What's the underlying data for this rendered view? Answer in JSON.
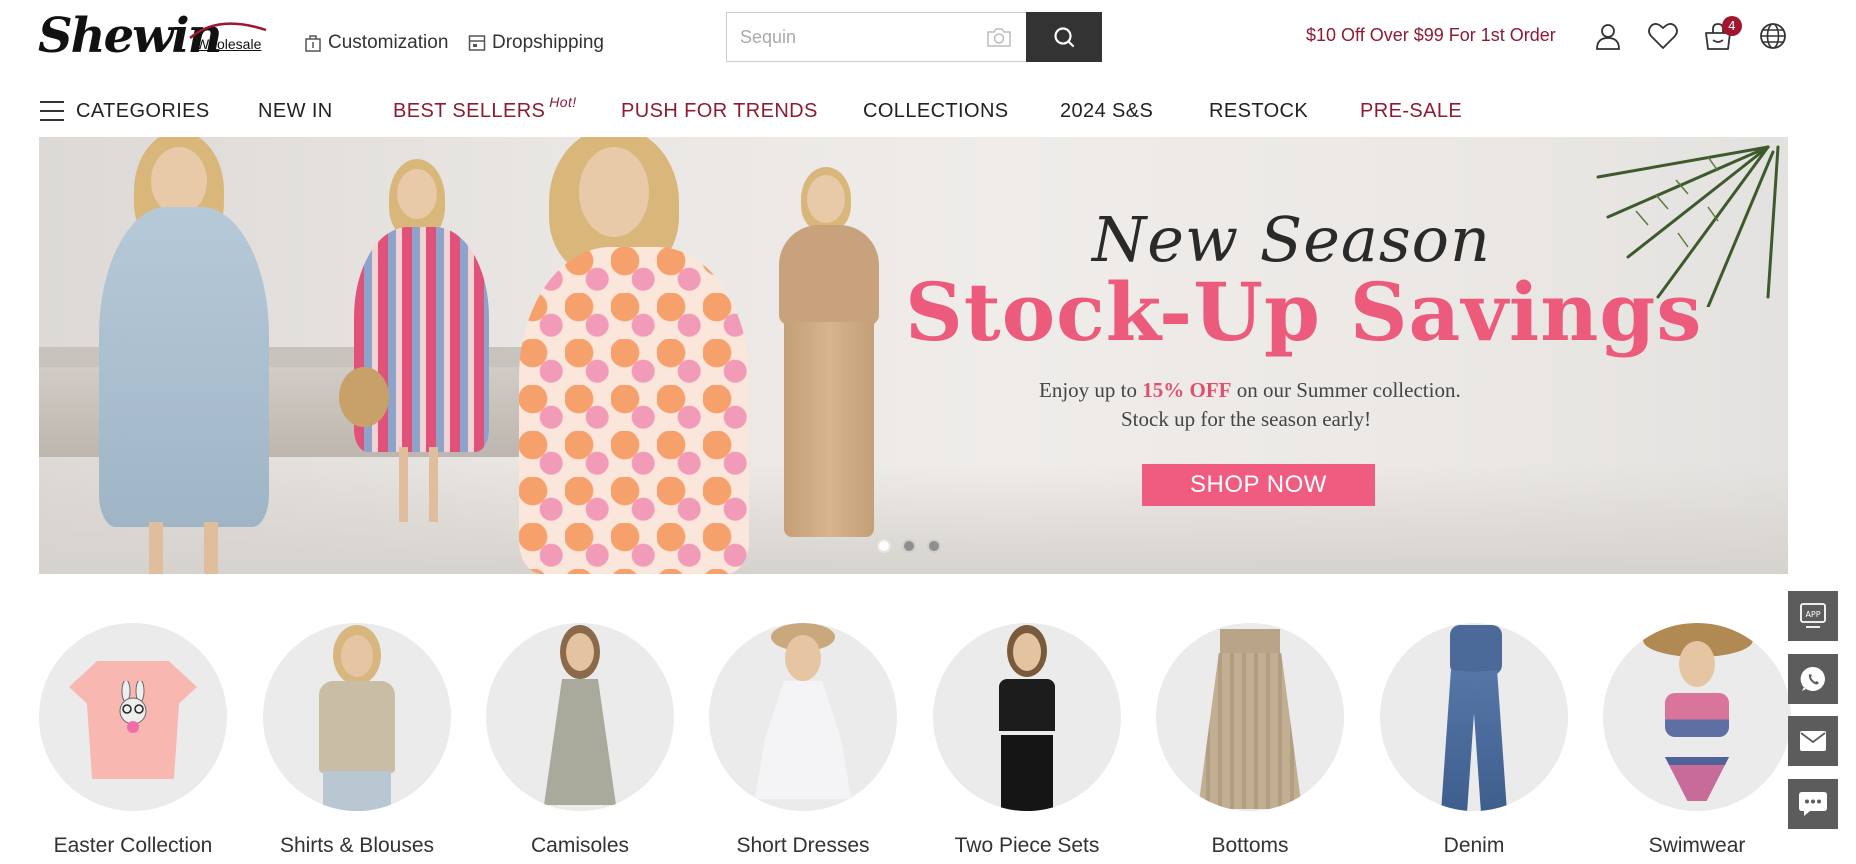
{
  "header": {
    "logo_text": "Shewin",
    "logo_sub": "Wholesale",
    "links": [
      {
        "label": "Customization",
        "icon": "customization-icon"
      },
      {
        "label": "Dropshipping",
        "icon": "dropshipping-icon"
      }
    ],
    "search": {
      "placeholder": "Sequin"
    },
    "promo": "$10 Off Over $99 For 1st Order",
    "cart_count": "4",
    "icons": [
      "account-icon",
      "wishlist-heart-icon",
      "cart-icon",
      "language-globe-icon"
    ]
  },
  "nav": {
    "categories_label": "CATEGORIES",
    "items": [
      {
        "label": "NEW IN"
      },
      {
        "label": "BEST SELLERS",
        "tag": "Hot!"
      },
      {
        "label": "PUSH FOR TRENDS"
      },
      {
        "label": "COLLECTIONS"
      },
      {
        "label": "2024 S&S"
      },
      {
        "label": "RESTOCK"
      },
      {
        "label": "PRE-SALE"
      }
    ]
  },
  "banner": {
    "title_line1": "New Season",
    "title_line2": "Stock-Up Savings",
    "subtitle_prefix": "Enjoy up to",
    "subtitle_highlight": "15% OFF",
    "subtitle_suffix": "on our Summer collection.",
    "subtitle_line2": "Stock up for the season early!",
    "cta": "SHOP NOW",
    "slide_count": 3,
    "active_slide": 1,
    "colors": {
      "accent_pink": "#ef5c80",
      "brand_red": "#8e1b34"
    }
  },
  "categories": [
    {
      "label": "Easter Collection"
    },
    {
      "label": "Shirts & Blouses"
    },
    {
      "label": "Camisoles"
    },
    {
      "label": "Short Dresses"
    },
    {
      "label": "Two Piece Sets"
    },
    {
      "label": "Bottoms"
    },
    {
      "label": "Denim"
    },
    {
      "label": "Swimwear"
    }
  ],
  "side_tools": [
    {
      "name": "app-download-icon",
      "label": "APP"
    },
    {
      "name": "whatsapp-icon"
    },
    {
      "name": "email-icon"
    },
    {
      "name": "chat-icon"
    }
  ]
}
